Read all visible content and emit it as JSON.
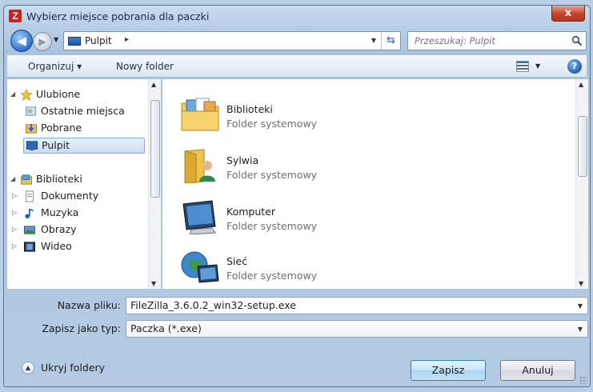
{
  "window": {
    "title": "Wybierz miejsce pobrania dla paczki",
    "app_icon_letter": "Z",
    "close_label": "x"
  },
  "address": {
    "location": "Pulpit",
    "separator": "▸",
    "search_placeholder": "Przeszukaj: Pulpit"
  },
  "toolbar": {
    "organize_label": "Organizuj ▾",
    "new_folder_label": "Nowy folder",
    "help_label": "?"
  },
  "nav": {
    "favorites": {
      "label": "Ulubione",
      "items": [
        {
          "label": "Ostatnie miejsca",
          "icon": "recent-places-icon"
        },
        {
          "label": "Pobrane",
          "icon": "downloads-icon"
        },
        {
          "label": "Pulpit",
          "icon": "desktop-icon",
          "selected": true
        }
      ]
    },
    "libraries": {
      "label": "Biblioteki",
      "items": [
        {
          "label": "Dokumenty",
          "icon": "documents-icon"
        },
        {
          "label": "Muzyka",
          "icon": "music-icon"
        },
        {
          "label": "Obrazy",
          "icon": "pictures-icon"
        },
        {
          "label": "Wideo",
          "icon": "video-icon"
        }
      ]
    }
  },
  "files": [
    {
      "name": "Biblioteki",
      "type": "Folder systemowy",
      "icon": "libraries-folder-icon"
    },
    {
      "name": "Sylwia",
      "type": "Folder systemowy",
      "icon": "user-folder-icon"
    },
    {
      "name": "Komputer",
      "type": "Folder systemowy",
      "icon": "computer-icon"
    },
    {
      "name": "Sieć",
      "type": "Folder systemowy",
      "icon": "network-icon"
    }
  ],
  "form": {
    "filename_label": "Nazwa pliku:",
    "filename_value": "FileZilla_3.6.0.2_win32-setup.exe",
    "filetype_label": "Zapisz jako typ:",
    "filetype_value": "Paczka (*.exe)"
  },
  "footer": {
    "hide_folders_label": "Ukryj foldery",
    "save_label": "Zapisz",
    "cancel_label": "Anuluj"
  },
  "colors": {
    "accent": "#3c7fb1",
    "close": "#c8412b",
    "selection": "#c9ddf4"
  }
}
